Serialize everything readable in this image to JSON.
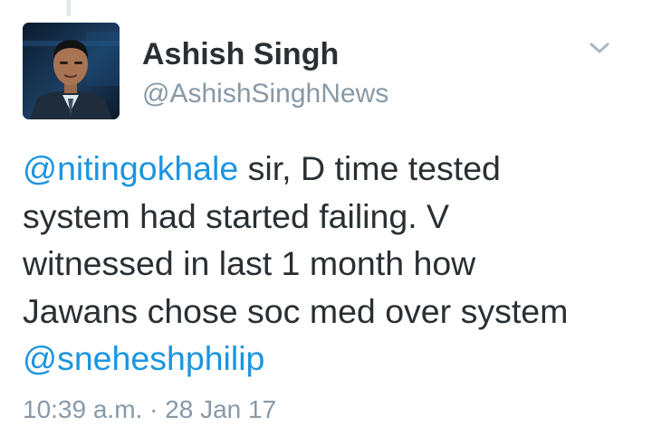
{
  "tweet": {
    "author": {
      "display_name": "Ashish Singh",
      "handle": "@AshishSinghNews",
      "avatar_icon": "profile-photo"
    },
    "menu_icon": "chevron-down-icon",
    "lines": [
      {
        "mention": "@nitingokhale",
        "text": " sir, D time tested"
      },
      {
        "text": "system had started failing. V"
      },
      {
        "text": "witnessed in last 1 month how"
      },
      {
        "text": "Jawans chose soc med over system"
      },
      {
        "mention": "@sneheshphilip"
      }
    ],
    "timestamp": "10:39 a.m. · 28 Jan 17"
  },
  "colors": {
    "mention": "#1b95e0",
    "text": "#292f33",
    "secondary": "#8899a6"
  }
}
